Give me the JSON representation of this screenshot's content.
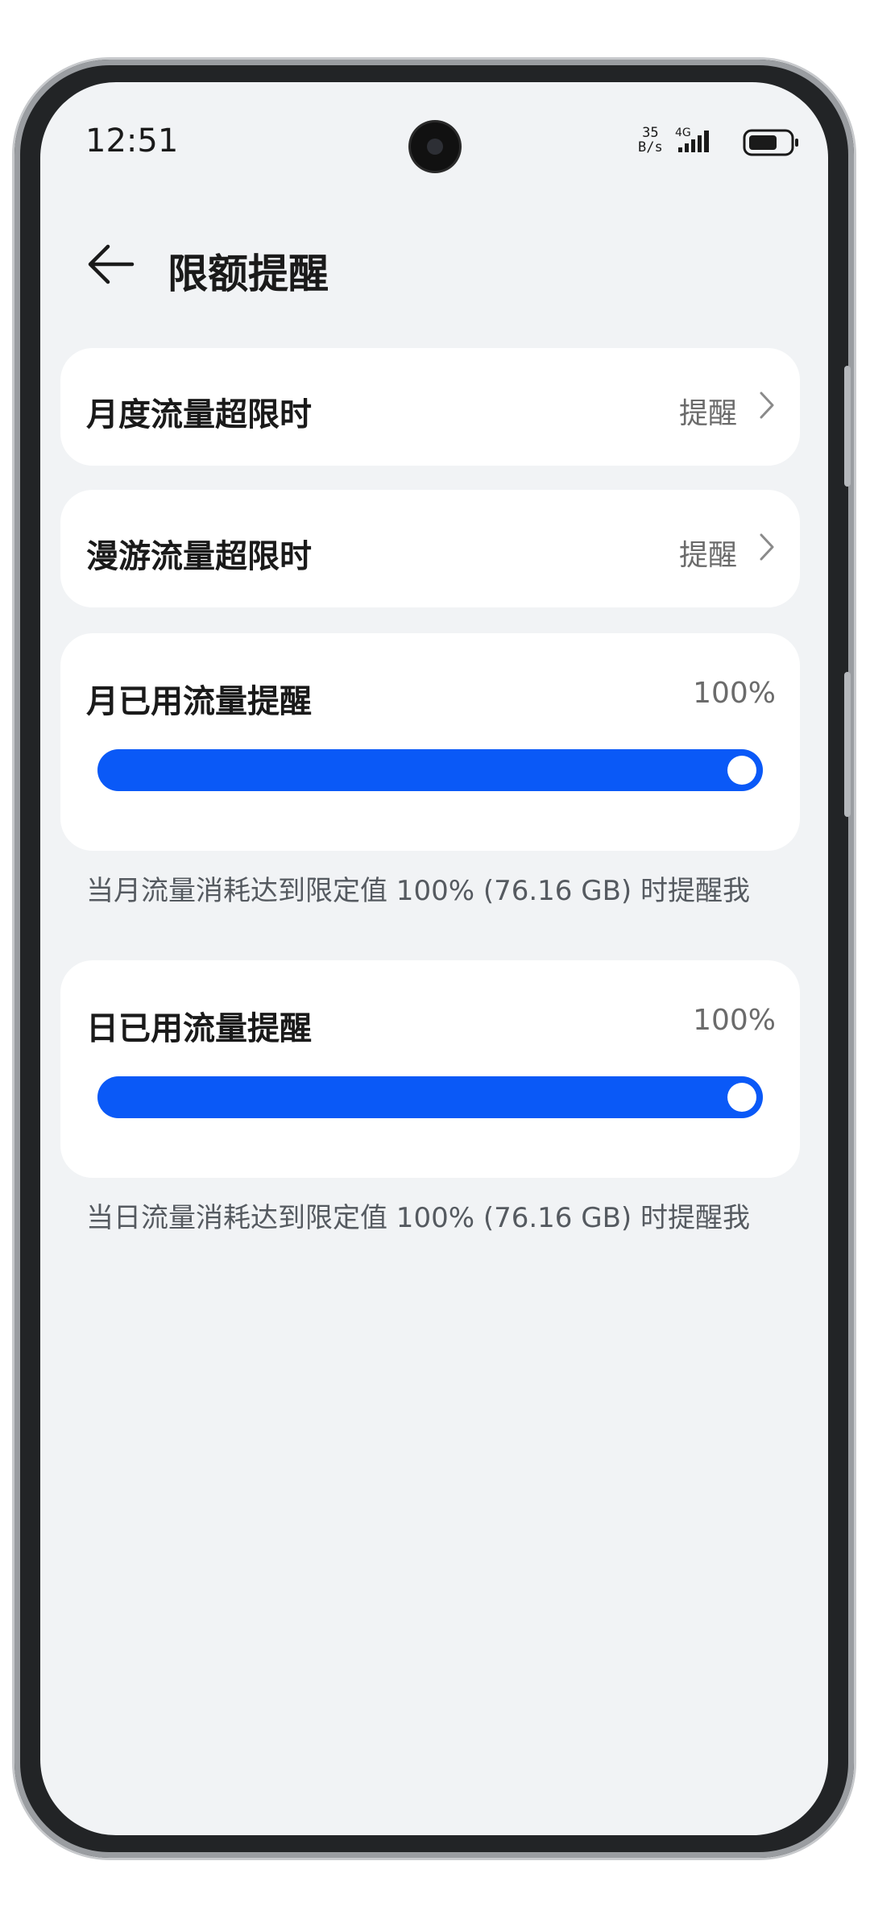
{
  "status_bar": {
    "time": "12:51",
    "net_speed_value": "35",
    "net_speed_unit": "B/s",
    "network_type": "4G",
    "icons": [
      "signal-icon",
      "battery-icon"
    ]
  },
  "header": {
    "title": "限额提醒",
    "back_icon": "back-arrow-icon"
  },
  "rows": [
    {
      "label": "月度流量超限时",
      "value": "提醒"
    },
    {
      "label": "漫游流量超限时",
      "value": "提醒"
    }
  ],
  "sliders": [
    {
      "label": "月已用流量提醒",
      "percent_text": "100%",
      "level": 1.0,
      "caption": "当月流量消耗达到限定值 100% (76.16 GB) 时提醒我"
    },
    {
      "label": "日已用流量提醒",
      "percent_text": "100%",
      "level": 1.0,
      "caption": "当日流量消耗达到限定值 100% (76.16 GB) 时提醒我"
    }
  ],
  "colors": {
    "accent": "#0a59f7",
    "background": "#f1f3f5",
    "card": "#ffffff",
    "secondary_text": "#6b6b6b"
  }
}
